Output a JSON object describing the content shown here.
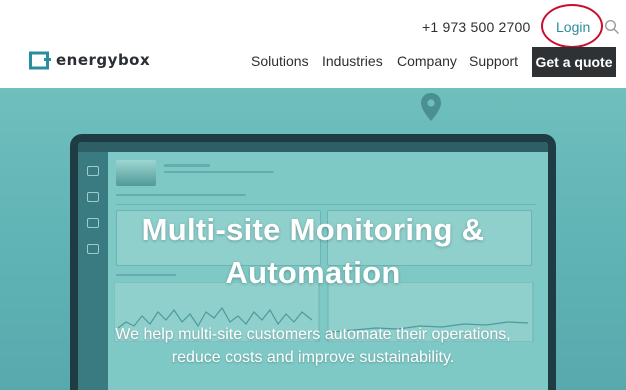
{
  "header": {
    "phone": "+1 973 500 2700",
    "login_label": "Login",
    "logo_text": "energybox",
    "nav": [
      "Solutions",
      "Industries",
      "Company",
      "Support"
    ],
    "cta_label": "Get a quote"
  },
  "hero": {
    "headline_line1": "Multi-site Monitoring &",
    "headline_line2": "Automation",
    "subtitle_line1": "We help multi-site customers automate their operations,",
    "subtitle_line2": "reduce costs and improve sustainability."
  },
  "icons": {
    "search": "search-icon",
    "logo": "energybox-logo-icon",
    "pin": "map-pin-icon"
  },
  "colors": {
    "accent": "#2a8d9d",
    "login_ring": "#c8102e",
    "cta_bg": "#2f3235",
    "hero_bg": "#62b5b6"
  }
}
